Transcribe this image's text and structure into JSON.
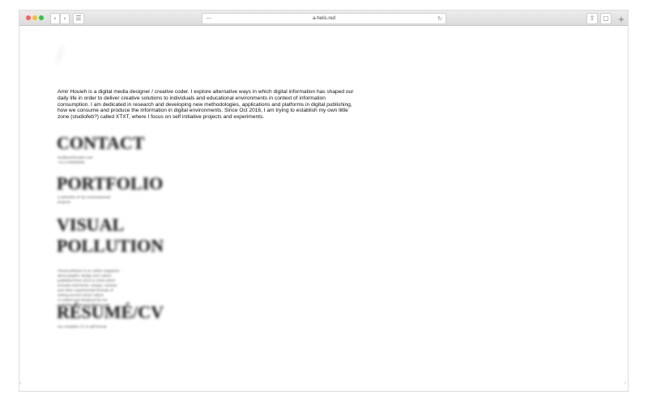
{
  "browser": {
    "url": "a-helis.red",
    "back_label": "‹",
    "forward_label": "›",
    "sidebar_label": "☰",
    "share_label": "⇧",
    "tabs_label": "▢",
    "new_tab_label": "+",
    "reload_label": "↻",
    "address_left_icon": "—",
    "left_edge_mark": "‹",
    "right_edge_mark": "›"
  },
  "page": {
    "logo": "/",
    "intro": "Amir Houieh is a digital media designer / creative coder. I explore alternative ways in which digital information has shaped our daily life in order to deliver creative solutions to individuals and educational environments in context of information consumption. I am dedicated in research and developing new methodologies, applications and platforms in digital publishing, how we consume and produce the information in digital environments. Since Oct 2016, I am trying to establish my own little zone (studiofeb?) called XTXT, where I focus on self initiative projects and experiments.",
    "sections": [
      {
        "heading": "CONTACT",
        "lines": [
          "me@amirhouieh.com",
          "+31 6 00000000"
        ]
      },
      {
        "heading": "PORTFOLIO",
        "lines": [
          "a selection of my commissioned",
          "projects"
        ]
      },
      {
        "heading": "VISUAL",
        "heading2": "POLLUTION",
        "lines": [
          "Visual pollution is an online magazine",
          "about graphic design and culture",
          "published from 2012 to 2016 which",
          "includes interviews, essays, reviews",
          "and other experimental formats of",
          "writing around visual culture",
          "co-edited and designed by me",
          "available at visual-pollution.com"
        ]
      },
      {
        "heading": "RÉSUMÉ/CV",
        "lines": [
          "my complete CV in pdf format"
        ]
      }
    ]
  }
}
